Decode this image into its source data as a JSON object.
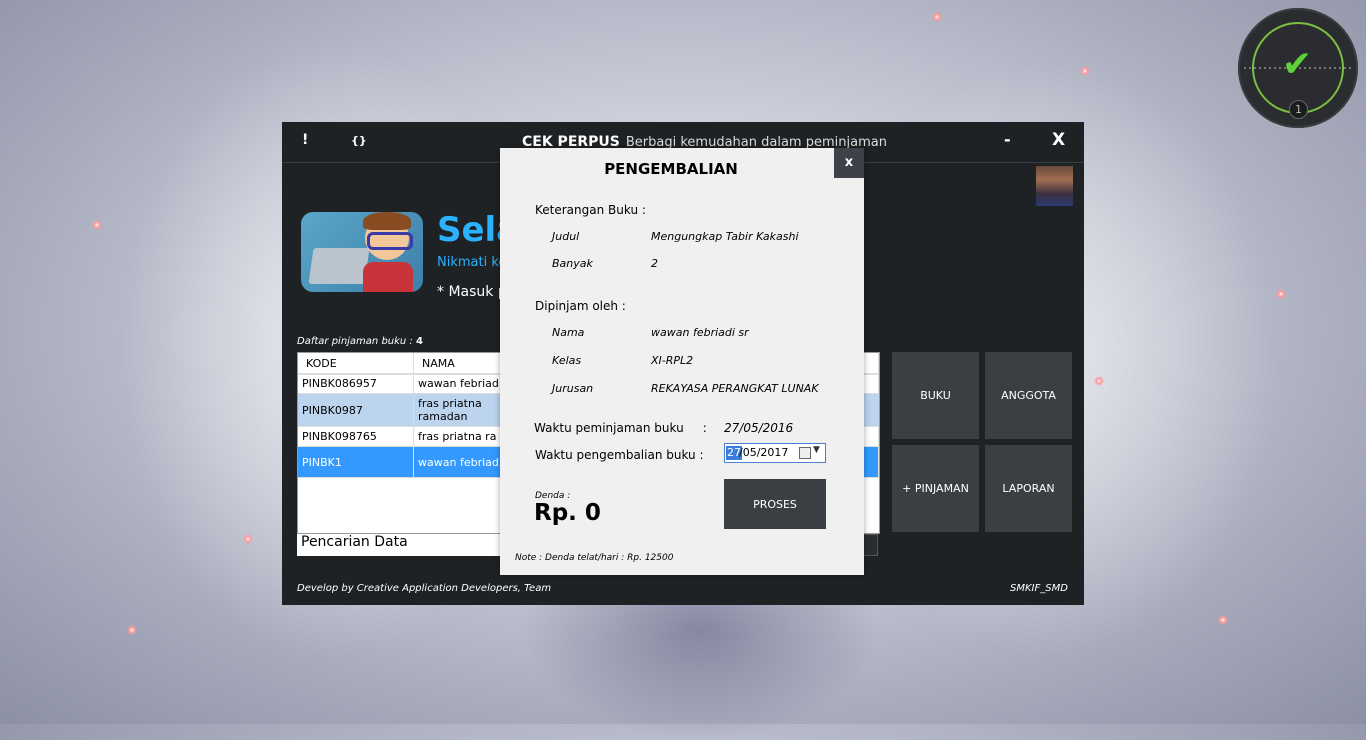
{
  "main_window": {
    "btn_info": "!",
    "btn_code": "{}",
    "app_name": "CEK PERPUS",
    "tagline": "Berbagi kemudahan dalam peminjaman",
    "minimize": "-",
    "close": "X",
    "welcome": "Sela",
    "subwelcome": "Nikmati ke",
    "note_masuk": "* Masuk p",
    "list_label": "Daftar pinjaman buku :",
    "list_count": "4",
    "table": {
      "headers": [
        "KODE",
        "NAMA"
      ],
      "rows": [
        [
          "PINBK086957",
          "wawan febriad"
        ],
        [
          "PINBK0987",
          "fras priatna ramadan"
        ],
        [
          "PINBK098765",
          "fras priatna ra"
        ],
        [
          "PINBK1",
          "wawan febriad"
        ]
      ]
    },
    "search_label": "Pencarian Data",
    "tiles": [
      "BUKU",
      "ANGGOTA",
      "+ PINJAMAN",
      "LAPORAN"
    ],
    "footer_left": "Develop by Creative Application Developers, Team",
    "footer_right": "SMKIF_SMD"
  },
  "modal": {
    "title": "PENGEMBALIAN",
    "close": "x",
    "sec_buku": "Keterangan Buku :",
    "judul_label": "Judul",
    "judul_value": "Mengungkap Tabir Kakashi",
    "banyak_label": "Banyak",
    "banyak_value": "2",
    "sec_peminjam": "Dipinjam oleh :",
    "nama_label": "Nama",
    "nama_value": "wawan febriadi sr",
    "kelas_label": "Kelas",
    "kelas_value": "XI-RPL2",
    "jurusan_label": "Jurusan",
    "jurusan_value": "REKAYASA PERANGKAT LUNAK",
    "waktu_pinjam_label": "Waktu peminjaman buku     :",
    "waktu_pinjam_value": "27/05/2016",
    "waktu_kembali_label": "Waktu pengembalian buku :",
    "waktu_kembali_day": "27",
    "waktu_kembali_rest": "/05/2017",
    "proses": "PROSES",
    "denda_label": "Denda :",
    "denda_value": "Rp. 0",
    "note": "Note : Denda telat/hari : Rp. 12500"
  },
  "widget": {
    "badge": "1",
    "status_icon": "check-icon"
  },
  "colors": {
    "accent": "#2bb2ff",
    "window_bg": "#1f2225",
    "tile_bg": "#3b3f44",
    "selected_row": "#3399ff",
    "alt_row": "#bcd4ee"
  }
}
